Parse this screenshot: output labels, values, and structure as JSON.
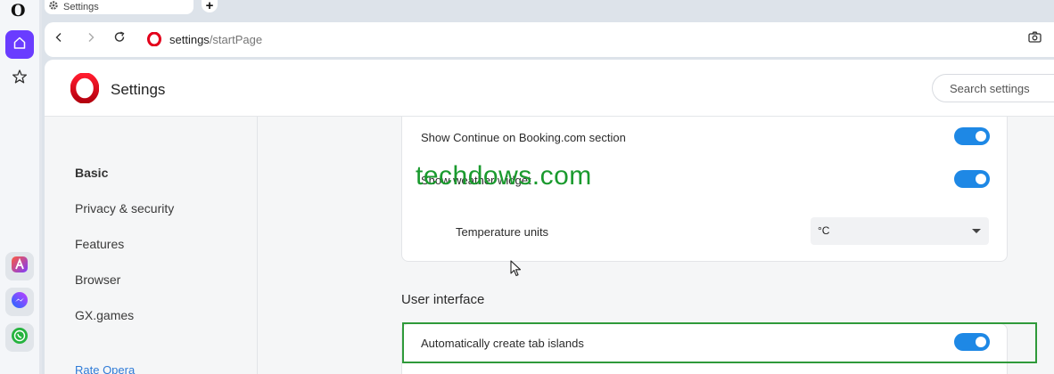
{
  "browser": {
    "logo_text": "O",
    "tab_title": "Settings",
    "new_tab_label": "+",
    "url_host": "settings",
    "url_path": "/startPage"
  },
  "sidebar": {
    "items": [
      {
        "name": "home",
        "icon": "home-icon",
        "active": true
      },
      {
        "name": "pinboards",
        "icon": "star-icon",
        "active": false
      }
    ],
    "apps": [
      "aria-icon",
      "messenger-icon",
      "whatsapp-icon"
    ]
  },
  "settings": {
    "title": "Settings",
    "search_placeholder": "Search settings",
    "nav": {
      "basic": "Basic",
      "privacy": "Privacy & security",
      "features": "Features",
      "browser": "Browser",
      "gx": "GX.games",
      "rate": "Rate Opera"
    },
    "start_page": {
      "booking_label": "Show Continue on Booking.com section",
      "booking_enabled": true,
      "weather_label": "Show weather widget",
      "weather_enabled": true,
      "temperature_label": "Temperature units",
      "temperature_value": "°C"
    },
    "user_interface": {
      "heading": "User interface",
      "tab_islands_label": "Automatically create tab islands",
      "tab_islands_enabled": true
    }
  },
  "watermark": "techdows.com",
  "colors": {
    "accent": "#1e88e5",
    "opera_red": "#e3001b",
    "sidebar_active": "#6a3cff",
    "highlight_border": "#2f9a3a",
    "watermark": "#1a9a2e"
  }
}
